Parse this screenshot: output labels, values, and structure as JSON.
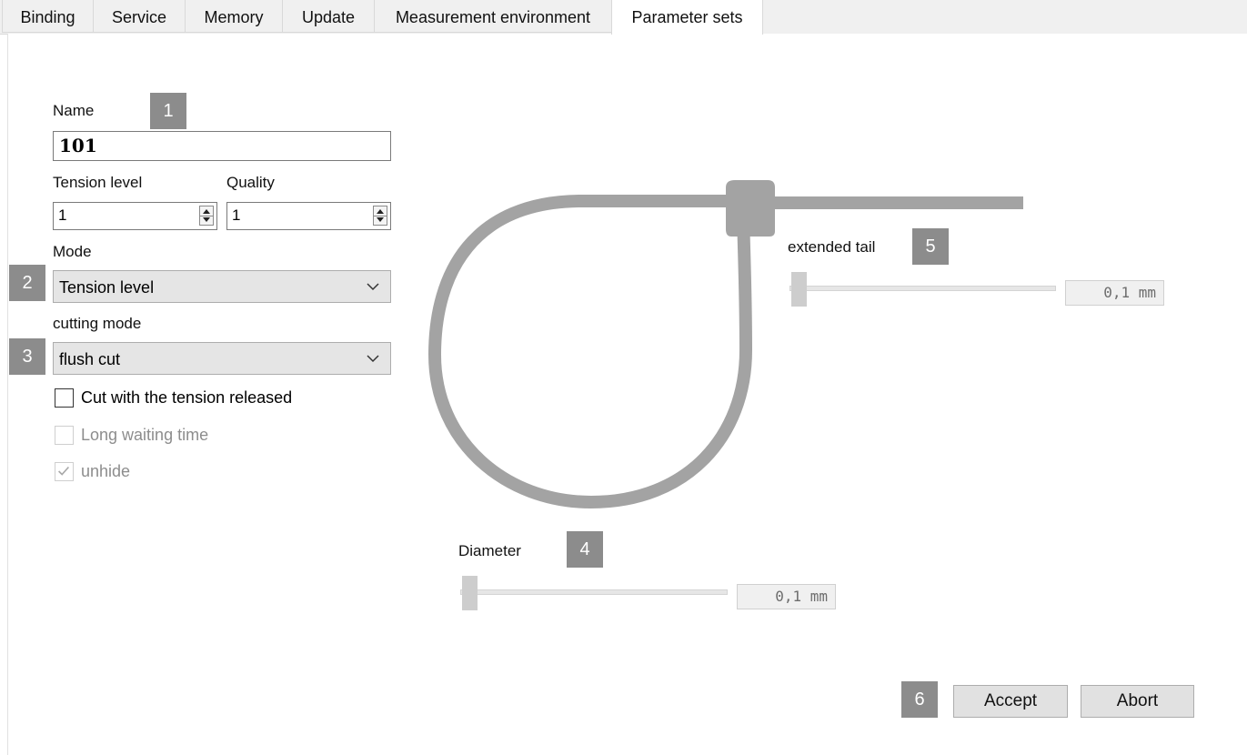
{
  "tabs": [
    {
      "label": "Binding"
    },
    {
      "label": "Service"
    },
    {
      "label": "Memory"
    },
    {
      "label": "Update"
    },
    {
      "label": "Measurement environment"
    },
    {
      "label": "Parameter sets"
    }
  ],
  "active_tab": "Parameter sets",
  "form": {
    "name_label": "Name",
    "name_value": "101",
    "tension_label": "Tension level",
    "tension_value": "1",
    "quality_label": "Quality",
    "quality_value": "1",
    "mode_label": "Mode",
    "mode_value": "Tension level",
    "cutting_label": "cutting mode",
    "cutting_value": "flush cut",
    "checkboxes": [
      {
        "label": "Cut with the tension released",
        "checked": false,
        "enabled": true
      },
      {
        "label": "Long waiting time",
        "checked": false,
        "enabled": false
      },
      {
        "label": "unhide",
        "checked": true,
        "enabled": false
      }
    ]
  },
  "diagram": {
    "tail_label": "extended tail",
    "tail_value": "0,1 mm",
    "tail_level": 0,
    "diameter_label": "Diameter",
    "diameter_value": "0,1 mm",
    "diameter_level": 0
  },
  "badges": [
    "1",
    "2",
    "3",
    "4",
    "5",
    "6"
  ],
  "buttons": {
    "accept": "Accept",
    "abort": "Abort"
  },
  "colors": {
    "badge": "#8c8c8c",
    "cable": "#a3a3a3"
  }
}
